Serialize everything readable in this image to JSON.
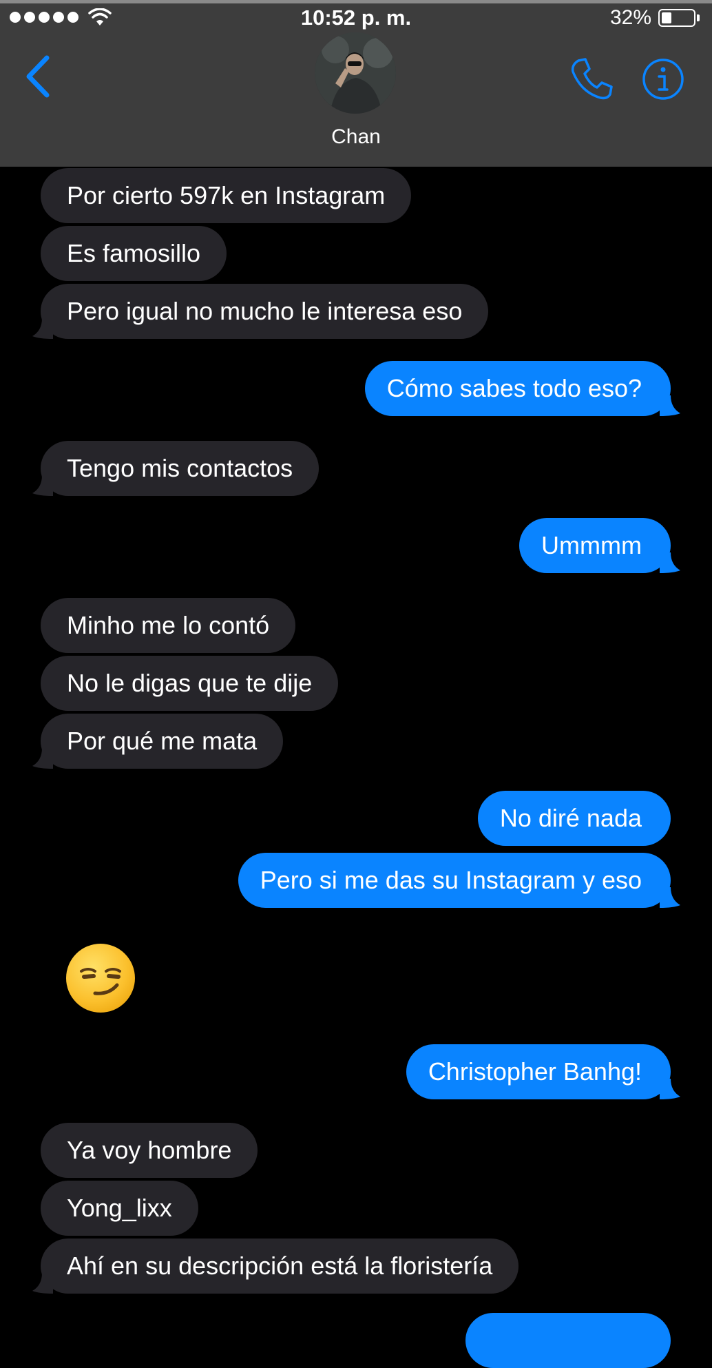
{
  "status_bar": {
    "time": "10:52 p. m.",
    "battery_percent_label": "32%",
    "battery_level": 0.32
  },
  "header": {
    "contact_name": "Chan",
    "back_icon": "chevron-left-icon",
    "call_icon": "phone-icon",
    "info_icon": "info-icon"
  },
  "colors": {
    "accent": "#0a84ff",
    "incoming_bubble": "#26252a",
    "header_bg": "#3d3d3d",
    "background": "#000000"
  },
  "messages": [
    {
      "direction": "incoming",
      "text": "Por cierto 597k en Instagram"
    },
    {
      "direction": "incoming",
      "text": "Es famosillo"
    },
    {
      "direction": "incoming",
      "text": "Pero igual no mucho le interesa eso"
    },
    {
      "direction": "outgoing",
      "text": "Cómo sabes todo eso?"
    },
    {
      "direction": "incoming",
      "text": "Tengo mis contactos"
    },
    {
      "direction": "outgoing",
      "text": "Ummmm"
    },
    {
      "direction": "incoming",
      "text": "Minho me lo contó"
    },
    {
      "direction": "incoming",
      "text": "No le digas que te dije"
    },
    {
      "direction": "incoming",
      "text": "Por qué me mata"
    },
    {
      "direction": "outgoing",
      "text": "No diré nada"
    },
    {
      "direction": "outgoing",
      "text": "Pero si me das su Instagram y eso"
    },
    {
      "direction": "incoming",
      "emoji": "smirking-face-emoji"
    },
    {
      "direction": "outgoing",
      "text": "Christopher Banhg!"
    },
    {
      "direction": "incoming",
      "text": "Ya voy hombre"
    },
    {
      "direction": "incoming",
      "text": "Yong_lixx"
    },
    {
      "direction": "incoming",
      "text": "Ahí en su descripción está la floristería"
    }
  ]
}
